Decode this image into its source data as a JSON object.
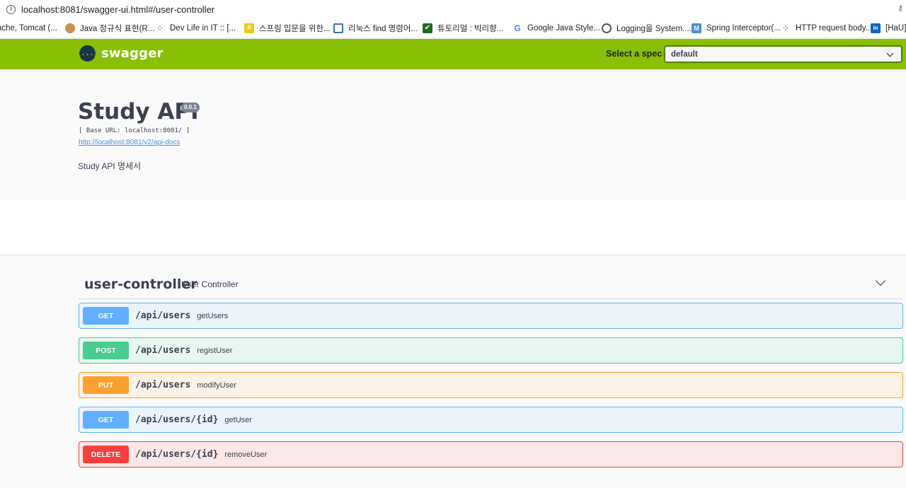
{
  "browser": {
    "url": "localhost:8081/swagger-ui.html#/user-controller",
    "bookmarks": [
      {
        "label": "ache, Tomcat (...",
        "icon": "page-icon",
        "color": "#ffffff"
      },
      {
        "label": "Java 정규식 표현(R...",
        "icon": "dog-icon",
        "color": "#b07a3c"
      },
      {
        "label": "Dev Life in IT :: [...",
        "icon": "dots-icon",
        "color": "#333333"
      },
      {
        "label": "스프링 입문을 위한...",
        "icon": "hash-icon",
        "color": "#f2c811"
      },
      {
        "label": "리눅스 find 명령어...",
        "icon": "monitor-icon",
        "color": "#4a6ea9"
      },
      {
        "label": "튜토리얼 : 빅리향...",
        "icon": "check-icon",
        "color": "#1e6b1e"
      },
      {
        "label": "Google Java Style...",
        "icon": "google-icon",
        "color": "#4285f4"
      },
      {
        "label": "Logging을 System....",
        "icon": "globe-icon",
        "color": "#555555"
      },
      {
        "label": "Spring Interceptor(...",
        "icon": "m-icon",
        "color": "#4a8fd8"
      },
      {
        "label": "HTTP request body...",
        "icon": "dots-icon",
        "color": "#333333"
      },
      {
        "label": "[HaU]",
        "icon": "linkedin-icon",
        "color": "#0a66c2"
      }
    ]
  },
  "topbar": {
    "logo_mark": "{...}",
    "logo_text": "swagger",
    "spec_label": "Select a spec",
    "spec_value": "default"
  },
  "info": {
    "title": "Study API",
    "version": "0.0.1",
    "base_url": "[ Base URL: localhost:8081/ ]",
    "docs_link": "http://localhost:8081/v2/api-docs",
    "description": "Study API 명세서"
  },
  "tag": {
    "name": "user-controller",
    "description": "User Controller"
  },
  "operations": [
    {
      "method": "GET",
      "path": "/api/users",
      "summary": "getUsers"
    },
    {
      "method": "POST",
      "path": "/api/users",
      "summary": "registUser"
    },
    {
      "method": "PUT",
      "path": "/api/users",
      "summary": "modifyUser"
    },
    {
      "method": "GET",
      "path": "/api/users/{id}",
      "summary": "getUser"
    },
    {
      "method": "DELETE",
      "path": "/api/users/{id}",
      "summary": "removeUser"
    }
  ],
  "colors": {
    "topbar": "#89bf04",
    "get": "#61affe",
    "post": "#49cc90",
    "put": "#fca130",
    "delete": "#f93e3e"
  }
}
